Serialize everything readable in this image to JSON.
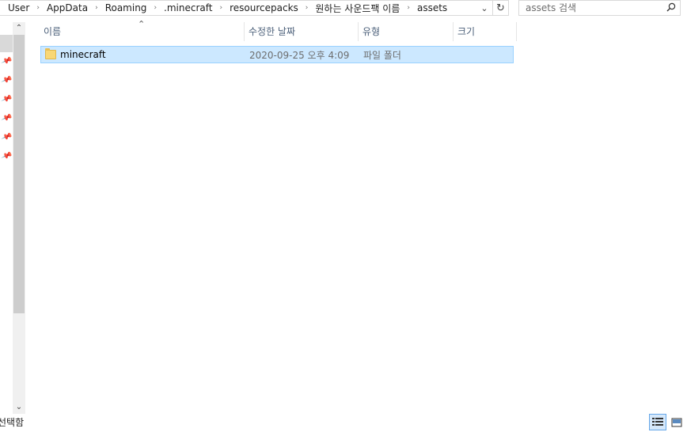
{
  "address": {
    "crumbs": [
      "User",
      "AppData",
      "Roaming",
      ".minecraft",
      "resourcepacks",
      "원하는 사운드팩 이름",
      "assets"
    ],
    "separator": "›",
    "dropdown_icon": "chevron-down-icon",
    "refresh_icon": "refresh-icon"
  },
  "search": {
    "placeholder": "assets 검색",
    "icon": "search-icon"
  },
  "columns": {
    "name": "이름",
    "date": "수정한 날짜",
    "type": "유형",
    "size": "크기"
  },
  "files": [
    {
      "name": "minecraft",
      "date": "2020-09-25 오후 4:09",
      "type": "파일 폴더",
      "size": ""
    }
  ],
  "status": {
    "text": "선택함"
  }
}
